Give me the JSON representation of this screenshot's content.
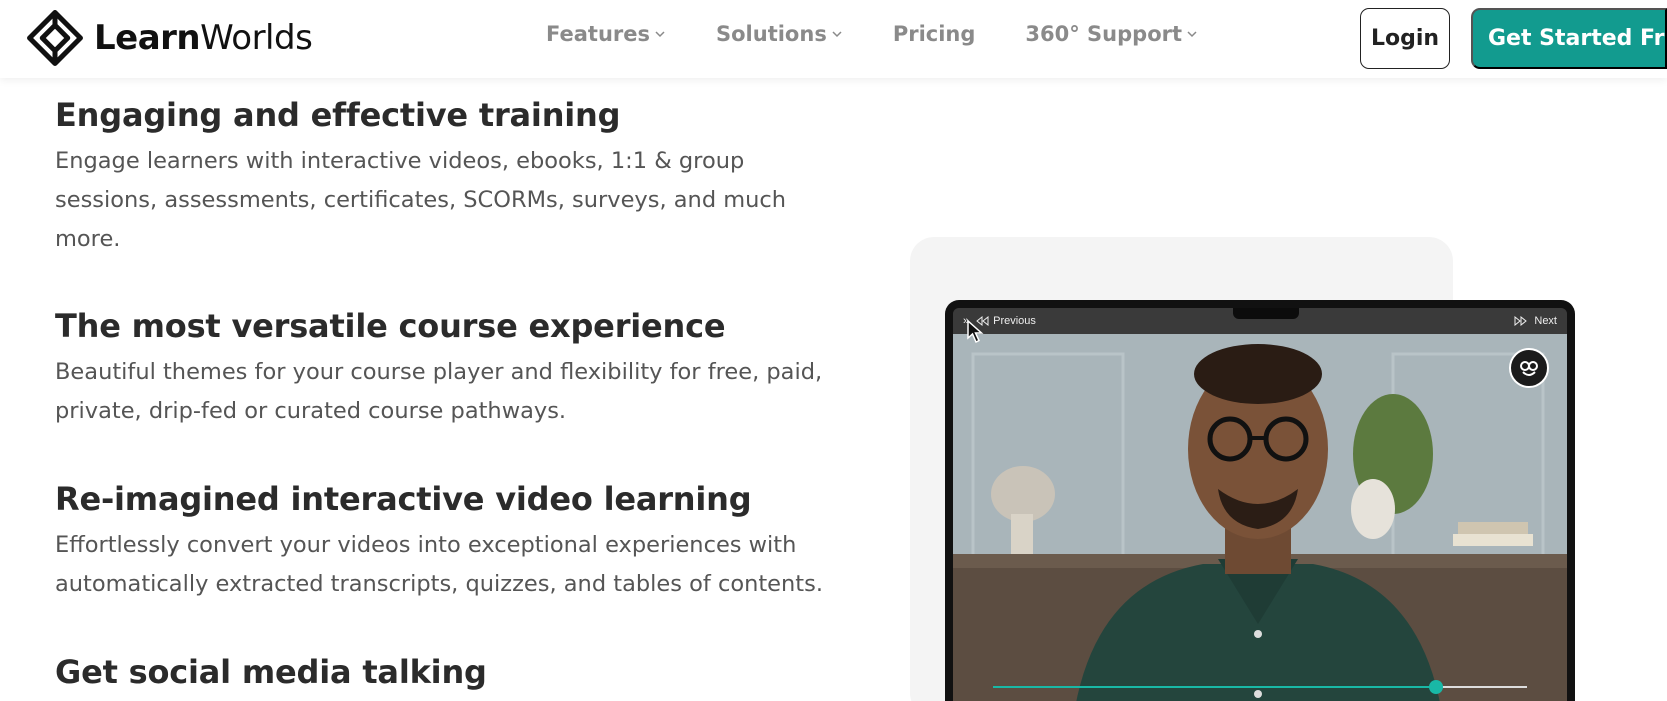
{
  "brand": {
    "name_bold": "Learn",
    "name_regular": "Worlds"
  },
  "nav": {
    "items": [
      {
        "label": "Features",
        "has_dropdown": true
      },
      {
        "label": "Solutions",
        "has_dropdown": true
      },
      {
        "label": "Pricing",
        "has_dropdown": false
      },
      {
        "label": "360° Support",
        "has_dropdown": true
      }
    ],
    "login_label": "Login",
    "cta_label": "Get Started Free"
  },
  "features": [
    {
      "title": "Engaging and effective training",
      "text": "Engage learners with interactive videos, ebooks, 1:1 & group sessions, assessments, certificates, SCORMs, surveys, and much more."
    },
    {
      "title": "The most versatile course experience",
      "text": "Beautiful themes for your course player and flexibility for free, paid, private, drip-fed or curated course pathways."
    },
    {
      "title": "Re-imagined interactive video learning",
      "text": "Effortlessly convert your videos into exceptional experiences with automatically extracted transcripts, quizzes, and tables of contents."
    },
    {
      "title": "Get social media talking",
      "text": ""
    }
  ],
  "player": {
    "previous_label": "Previous",
    "next_label": "Next",
    "progress": 0.83
  },
  "colors": {
    "accent": "#129b8f",
    "progress": "#19b8a6",
    "nav_text": "#8a8a8a"
  }
}
